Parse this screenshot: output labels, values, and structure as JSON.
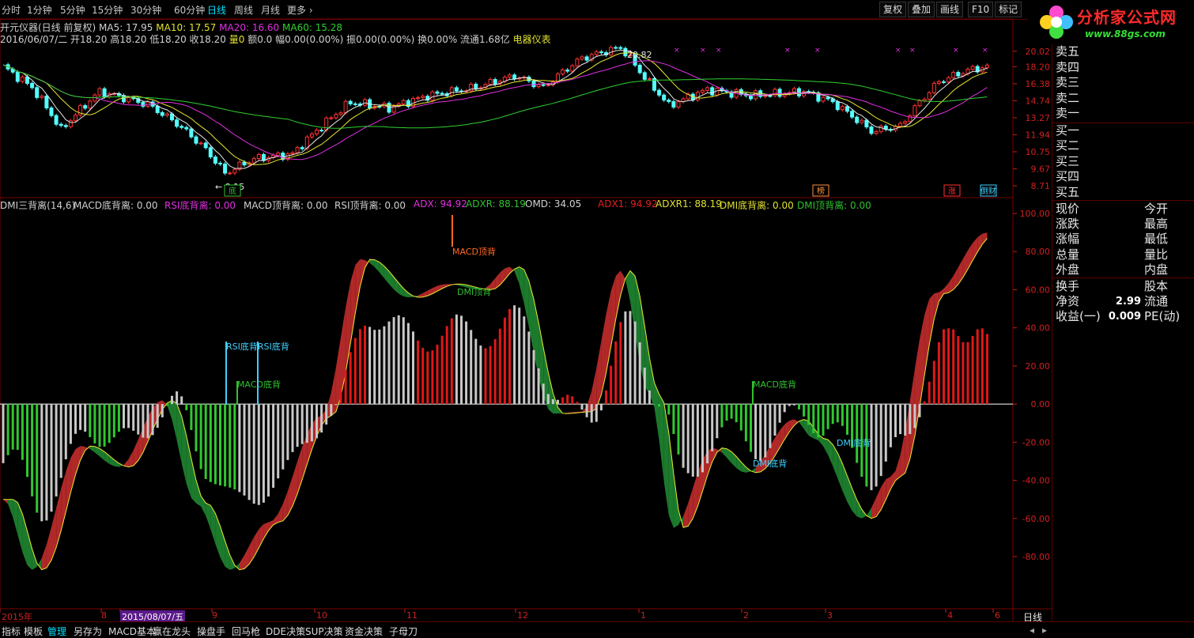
{
  "periods": [
    "分时",
    "1分钟",
    "5分钟",
    "15分钟",
    "30分钟",
    "60分钟",
    "日线",
    "周线",
    "月线",
    "更多 ›"
  ],
  "active_period": "日线",
  "right_buttons": [
    "复权",
    "叠加",
    "画线",
    "F10",
    "标记"
  ],
  "logo": {
    "main": "分析家公式网",
    "sub": "www.88gs.com"
  },
  "main_info": {
    "title": "开元仪器(日线 前复权)",
    "ma5": "MA5: 17.95",
    "ma10": "MA10: 17.57",
    "ma20": "MA20: 16.60",
    "ma60": "MA60: 15.28",
    "ohlc": "2016/06/07/二 开18.20 高18.20 低18.20 收18.20",
    "vol": "量0",
    "rest": "额0.0 幅0.00(0.00%) 振0.00(0.00%) 换0.00% 流通1.68亿",
    "sector": "电器仪表"
  },
  "ind_info": [
    {
      "text": "DMI三背离(14,6)",
      "color": "#d0d0d0"
    },
    {
      "text": "MACD底背离: 0.00",
      "color": "#d0d0d0"
    },
    {
      "text": "RSI底背离: 0.00",
      "color": "#e030e0"
    },
    {
      "text": "MACD顶背离: 0.00",
      "color": "#d0d0d0"
    },
    {
      "text": "RSI顶背离: 0.00",
      "color": "#d0d0d0"
    },
    {
      "text": "ADX: 94.92",
      "color": "#e030e0"
    },
    {
      "text": "ADXR: 88.19",
      "color": "#30c030"
    },
    {
      "text": "OMD: 34.05",
      "color": "#d0d0d0"
    },
    {
      "text": "ADX1: 94.92",
      "color": "#e02020"
    },
    {
      "text": "ADXR1: 88.19",
      "color": "#e0e030"
    },
    {
      "text": "DMI底背离: 0.00",
      "color": "#e0e030"
    },
    {
      "text": "DMI顶背离: 0.00",
      "color": "#30c030"
    }
  ],
  "price_axis": [
    "20.02",
    "18.20",
    "16.38",
    "14.74",
    "13.27",
    "11.94",
    "10.75",
    "9.67",
    "8.71"
  ],
  "ind_axis": [
    "100.00",
    "80.00",
    "60.00",
    "40.00",
    "20.00",
    "0.00",
    "-20.00",
    "-40.00",
    "-60.00",
    "-80.00"
  ],
  "price_marks": {
    "high": "20.82",
    "low": "9.15"
  },
  "flag_marks": [
    "底",
    "榜",
    "涨",
    "倒财"
  ],
  "signals": [
    {
      "text": "MACD顶背",
      "color": "#ff6a20"
    },
    {
      "text": "DMI顶背",
      "color": "#30c030"
    },
    {
      "text": "RSI底背RSI底背",
      "color": "#40d0ff"
    },
    {
      "text": "MACD底背",
      "color": "#30c030"
    },
    {
      "text": "MACD底背",
      "color": "#30c030"
    },
    {
      "text": "DMI底背",
      "color": "#40d0ff"
    },
    {
      "text": "DMI底背",
      "color": "#40d0ff"
    }
  ],
  "dates": [
    "2015年",
    "8",
    "2015/08/07/五",
    "9",
    "10",
    "11",
    "12",
    "1",
    "2",
    "3",
    "4",
    "6"
  ],
  "period_label": "日线",
  "quote": {
    "sell": [
      "卖五",
      "卖四",
      "卖三",
      "卖二",
      "卖一"
    ],
    "buy": [
      "买一",
      "买二",
      "买三",
      "买四",
      "买五"
    ],
    "fields": [
      [
        "现价",
        "今开"
      ],
      [
        "涨跌",
        "最高"
      ],
      [
        "涨幅",
        "最低"
      ],
      [
        "总量",
        "量比"
      ],
      [
        "外盘",
        "内盘"
      ]
    ],
    "extra": [
      {
        "label": "换手",
        "value": "",
        "label2": "股本"
      },
      {
        "label": "净资",
        "value": "2.99",
        "label2": "流通"
      },
      {
        "label": "收益(一)",
        "value": "0.009",
        "label2": "PE(动)"
      }
    ]
  },
  "bottom_tabs": [
    "指标",
    "模板",
    "管理",
    "另存为",
    "MACD基本",
    "赢在龙头",
    "操盘手",
    "回马枪",
    "DDE决策",
    "SUP决策",
    "资金决策",
    "子母刀"
  ],
  "active_bottom": "管理",
  "chart_data": [
    {
      "type": "candlestick",
      "title": "开元仪器(日线 前复权)",
      "series": [
        {
          "name": "MA5",
          "last": 17.95
        },
        {
          "name": "MA10",
          "last": 17.57
        },
        {
          "name": "MA20",
          "last": 16.6
        },
        {
          "name": "MA60",
          "last": 15.28
        }
      ],
      "ylim": [
        8.5,
        20.9
      ],
      "annotations": [
        "20.82",
        "9.15"
      ]
    },
    {
      "type": "bar",
      "title": "DMI三背离(14,6)",
      "ylim": [
        -90,
        100
      ],
      "series": [
        {
          "name": "ADX",
          "last": 94.92
        },
        {
          "name": "ADXR",
          "last": 88.19
        },
        {
          "name": "OMD",
          "last": 34.05
        }
      ]
    }
  ]
}
